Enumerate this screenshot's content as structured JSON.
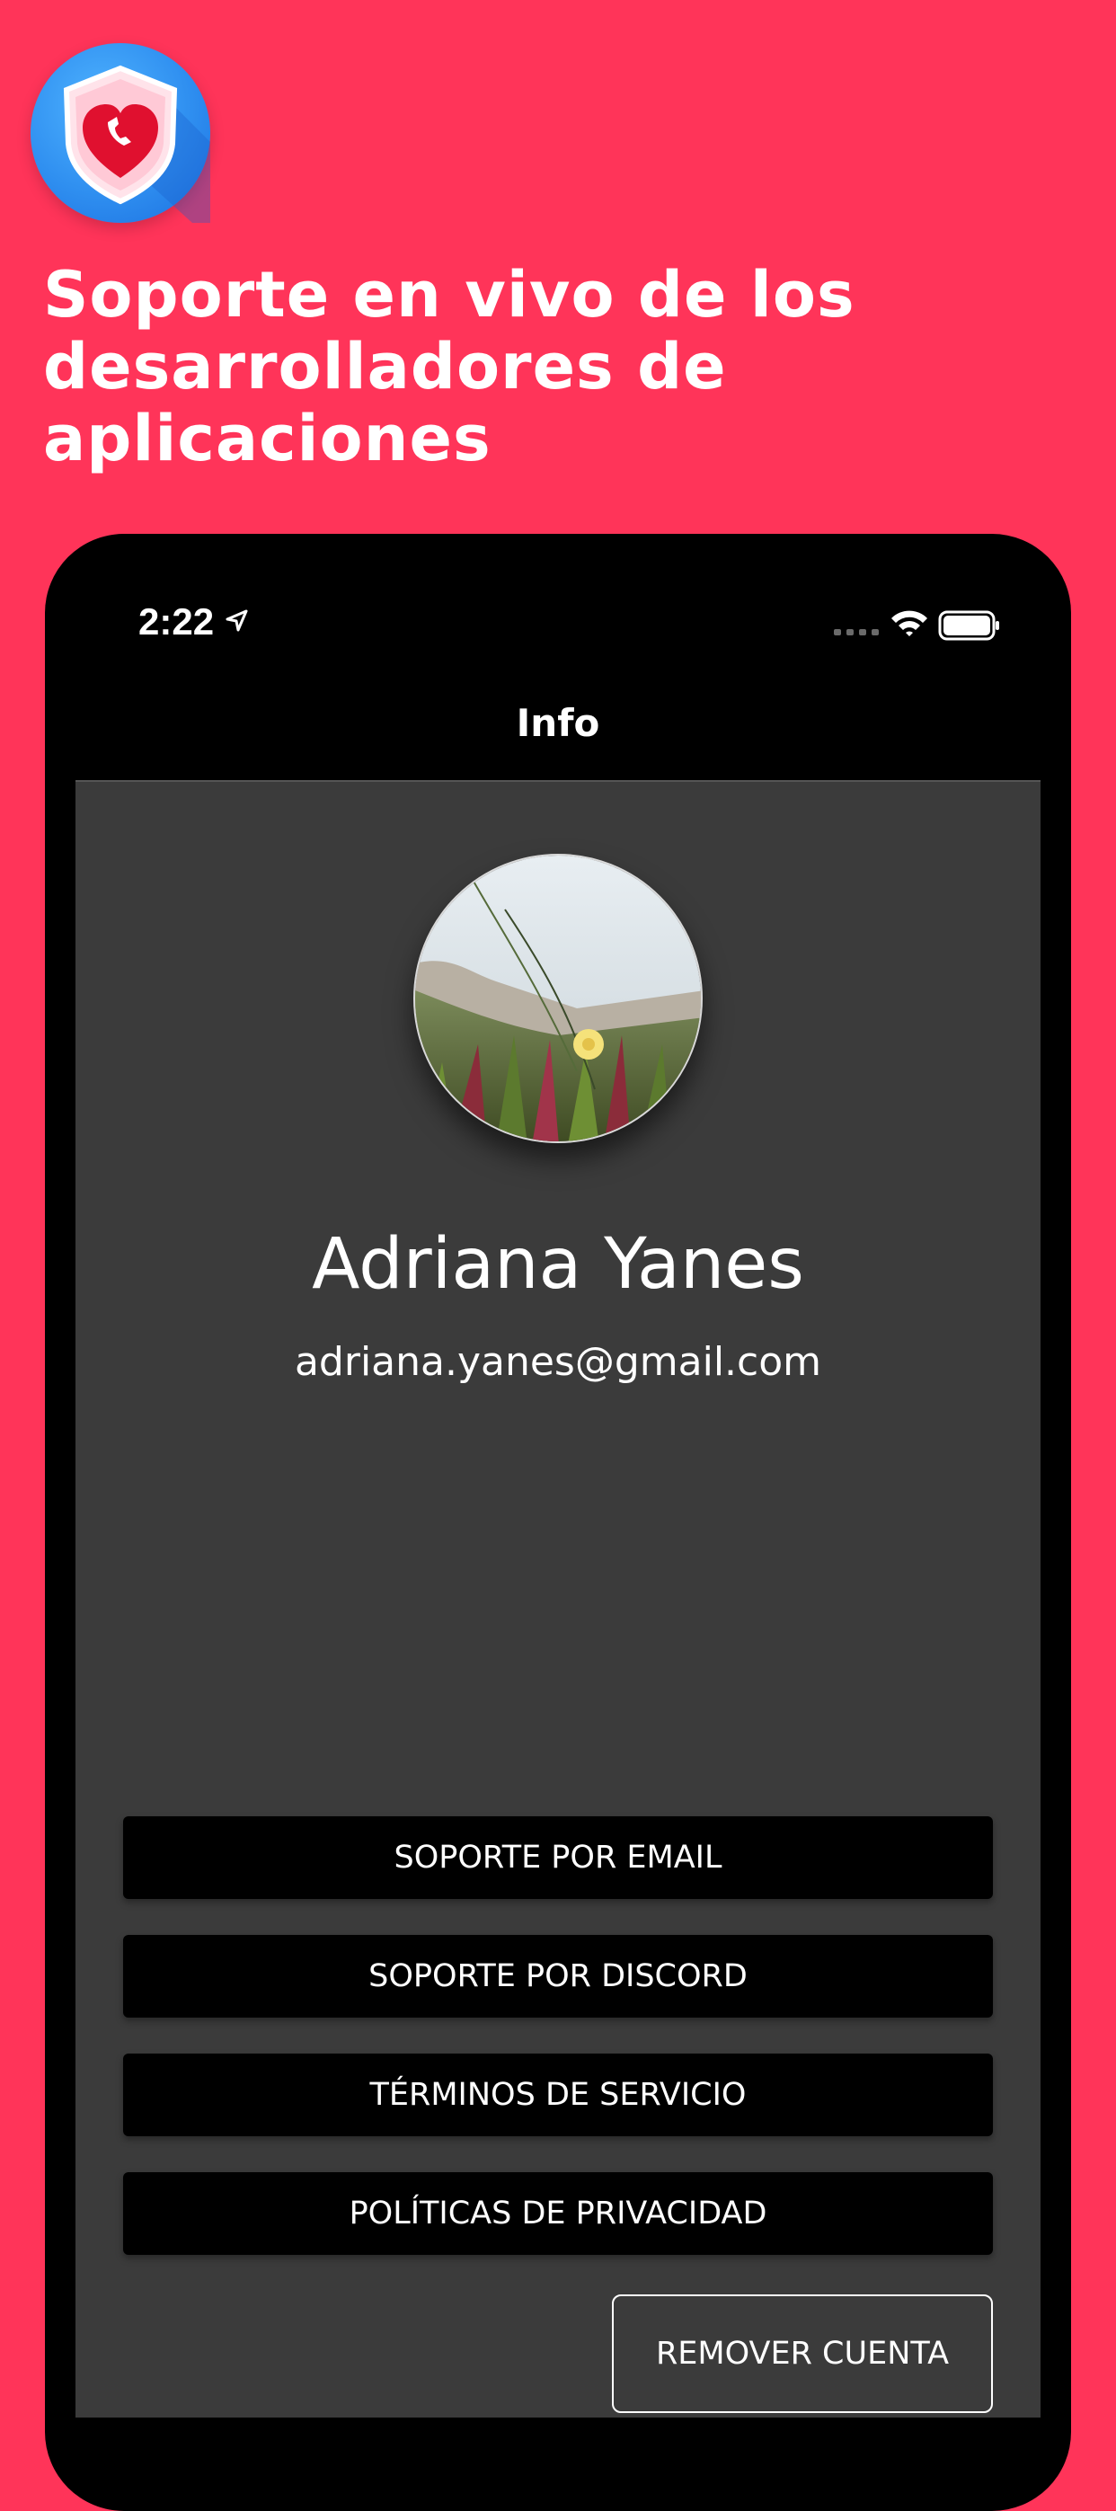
{
  "promo": {
    "headline": "Soporte en vivo de los desarrolladores de aplicaciones",
    "background_color": "#FF3459",
    "app_icon": "heart-shield-icon"
  },
  "status_bar": {
    "time": "2:22",
    "icons": [
      "location-arrow-icon",
      "cellular-signal-icon",
      "wifi-icon",
      "battery-icon"
    ]
  },
  "nav": {
    "title": "Info"
  },
  "profile": {
    "avatar": "profile-photo",
    "name": "Adriana Yanes",
    "email": "adriana.yanes@gmail.com"
  },
  "actions": {
    "email_support": "SOPORTE POR EMAIL",
    "discord_support": "SOPORTE POR DISCORD",
    "terms": "TÉRMINOS DE SERVICIO",
    "privacy": "POLÍTICAS DE PRIVACIDAD",
    "remove_account": "REMOVER CUENTA"
  },
  "colors": {
    "screen_background": "#3B3B3B",
    "button_background": "#000000",
    "text": "#FFFFFF"
  }
}
